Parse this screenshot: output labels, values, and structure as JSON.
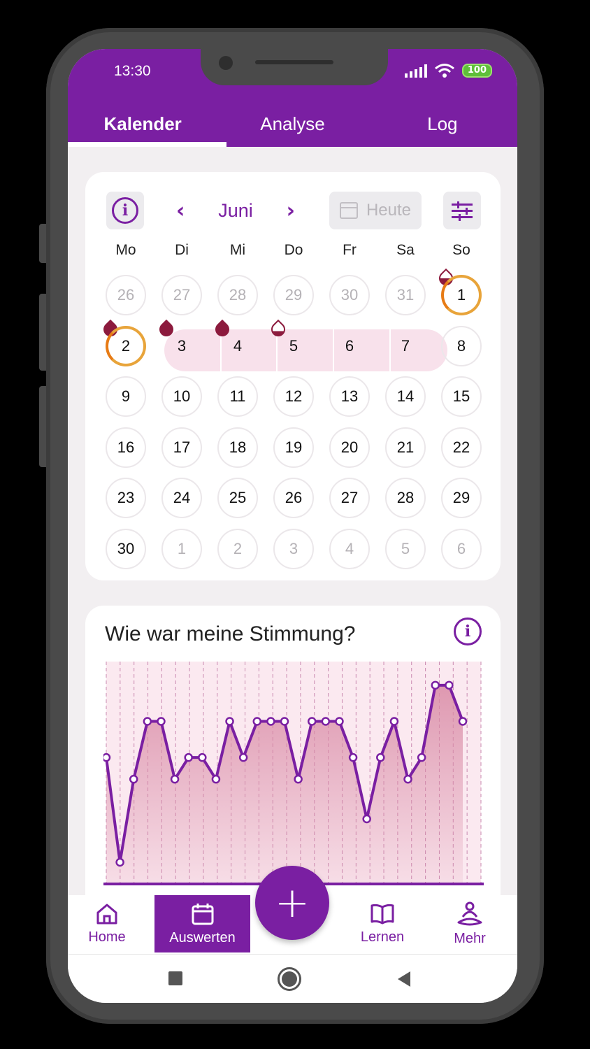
{
  "status": {
    "time": "13:30",
    "battery": "100"
  },
  "tabs": [
    {
      "label": "Kalender",
      "active": true
    },
    {
      "label": "Analyse",
      "active": false
    },
    {
      "label": "Log",
      "active": false
    }
  ],
  "calendar": {
    "month": "Juni",
    "today_label": "Heute",
    "weekdays": [
      "Mo",
      "Di",
      "Mi",
      "Do",
      "Fr",
      "Sa",
      "So"
    ],
    "weeks": [
      [
        {
          "d": "26",
          "muted": true
        },
        {
          "d": "27",
          "muted": true
        },
        {
          "d": "28",
          "muted": true
        },
        {
          "d": "29",
          "muted": true
        },
        {
          "d": "30",
          "muted": true
        },
        {
          "d": "31",
          "muted": true
        },
        {
          "d": "1",
          "ring": true,
          "drop": "half"
        }
      ],
      [
        {
          "d": "2",
          "ring": true,
          "drop": "full"
        },
        {
          "d": "3",
          "period": true,
          "drop": "full"
        },
        {
          "d": "4",
          "period": true,
          "drop": "full"
        },
        {
          "d": "5",
          "period": true,
          "drop": "light"
        },
        {
          "d": "6",
          "period": true
        },
        {
          "d": "7",
          "period": true
        },
        {
          "d": "8"
        }
      ],
      [
        {
          "d": "9"
        },
        {
          "d": "10"
        },
        {
          "d": "11"
        },
        {
          "d": "12"
        },
        {
          "d": "13"
        },
        {
          "d": "14"
        },
        {
          "d": "15"
        }
      ],
      [
        {
          "d": "16"
        },
        {
          "d": "17"
        },
        {
          "d": "18"
        },
        {
          "d": "19"
        },
        {
          "d": "20"
        },
        {
          "d": "21"
        },
        {
          "d": "22"
        }
      ],
      [
        {
          "d": "23"
        },
        {
          "d": "24"
        },
        {
          "d": "25"
        },
        {
          "d": "26"
        },
        {
          "d": "27"
        },
        {
          "d": "28"
        },
        {
          "d": "29"
        }
      ],
      [
        {
          "d": "30"
        },
        {
          "d": "1",
          "muted": true
        },
        {
          "d": "2",
          "muted": true
        },
        {
          "d": "3",
          "muted": true
        },
        {
          "d": "4",
          "muted": true
        },
        {
          "d": "5",
          "muted": true
        },
        {
          "d": "6",
          "muted": true
        }
      ]
    ]
  },
  "mood": {
    "title": "Wie war meine Stimmung?"
  },
  "chart_data": {
    "type": "area",
    "title": "Wie war meine Stimmung?",
    "x": [
      1,
      2,
      3,
      4,
      5,
      6,
      7,
      8,
      9,
      10,
      11,
      12,
      13,
      14,
      15,
      16,
      17,
      18,
      19,
      20,
      21,
      22,
      23,
      24,
      25,
      26,
      27
    ],
    "values": [
      3.5,
      0.6,
      2.9,
      4.5,
      4.5,
      2.9,
      3.5,
      3.5,
      2.9,
      4.5,
      3.5,
      4.5,
      4.5,
      4.5,
      2.9,
      4.5,
      4.5,
      4.5,
      3.5,
      1.8,
      3.5,
      4.5,
      2.9,
      3.5,
      5.5,
      5.5,
      4.5
    ],
    "ylim": [
      0,
      6
    ],
    "grid": true,
    "line_color": "#7a1fa2",
    "fill_color": "#d98aa5"
  },
  "bottom_nav": {
    "home": "Home",
    "auswerten": "Auswerten",
    "lernen": "Lernen",
    "mehr": "Mehr",
    "fab": "+"
  },
  "colors": {
    "primary": "#7a1fa2",
    "period_band": "#f8e1eb",
    "ring": "#e8a43a",
    "drop": "#8c1a3d"
  }
}
